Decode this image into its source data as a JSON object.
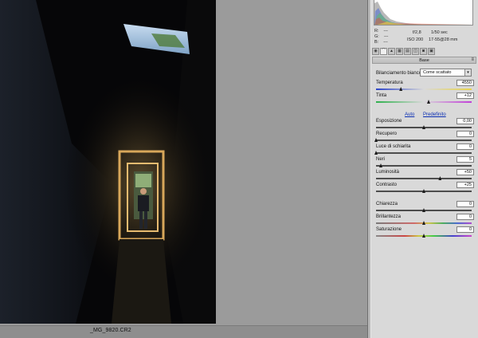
{
  "status_bar": {
    "filename": "_MG_9820.CR2"
  },
  "readout": {
    "r_label": "R:",
    "r_value": "---",
    "g_label": "G:",
    "g_value": "---",
    "b_label": "B:",
    "b_value": "---",
    "aperture": "f/2,8",
    "shutter": "1/50 sec",
    "iso": "ISO 200",
    "lens": "17-55@28 mm"
  },
  "panel": {
    "section_title": "Base",
    "white_balance_label": "Bilanciamento bianco:",
    "white_balance_value": "Come scattato",
    "auto_link": "Auto",
    "default_link": "Predefinito"
  },
  "sliders": [
    {
      "label": "Temperatura",
      "value": "4550",
      "position": 0.26,
      "track": "temperature"
    },
    {
      "label": "Tinta",
      "value": "+12",
      "position": 0.55,
      "track": "tint"
    },
    {
      "label": "Esposizione",
      "value": "0,00",
      "position": 0.5,
      "track": "gray"
    },
    {
      "label": "Recupero",
      "value": "0",
      "position": 0.0,
      "track": "gray"
    },
    {
      "label": "Luce di schiarita",
      "value": "0",
      "position": 0.0,
      "track": "gray"
    },
    {
      "label": "Neri",
      "value": "5",
      "position": 0.05,
      "track": "gray"
    },
    {
      "label": "Luminosità",
      "value": "+50",
      "position": 0.67,
      "track": "gray"
    },
    {
      "label": "Contrasto",
      "value": "+25",
      "position": 0.5,
      "track": "gray"
    },
    {
      "label": "Chiarezza",
      "value": "0",
      "position": 0.5,
      "track": "gray"
    },
    {
      "label": "Brillantezza",
      "value": "0",
      "position": 0.5,
      "track": "vibrance"
    },
    {
      "label": "Saturazione",
      "value": "0",
      "position": 0.5,
      "track": "saturation"
    }
  ],
  "tabs": [
    {
      "icon": "camera-icon"
    },
    {
      "icon": "curve-icon"
    },
    {
      "icon": "detail-icon"
    },
    {
      "icon": "hsl-icon"
    },
    {
      "icon": "split-toning-icon"
    },
    {
      "icon": "lens-icon"
    },
    {
      "icon": "camera-calibration-icon"
    },
    {
      "icon": "presets-icon"
    }
  ],
  "colors": {
    "panel_bg": "#d9d9d9",
    "canvas_bg": "#9b9b9b",
    "link": "#0b2fb3"
  }
}
